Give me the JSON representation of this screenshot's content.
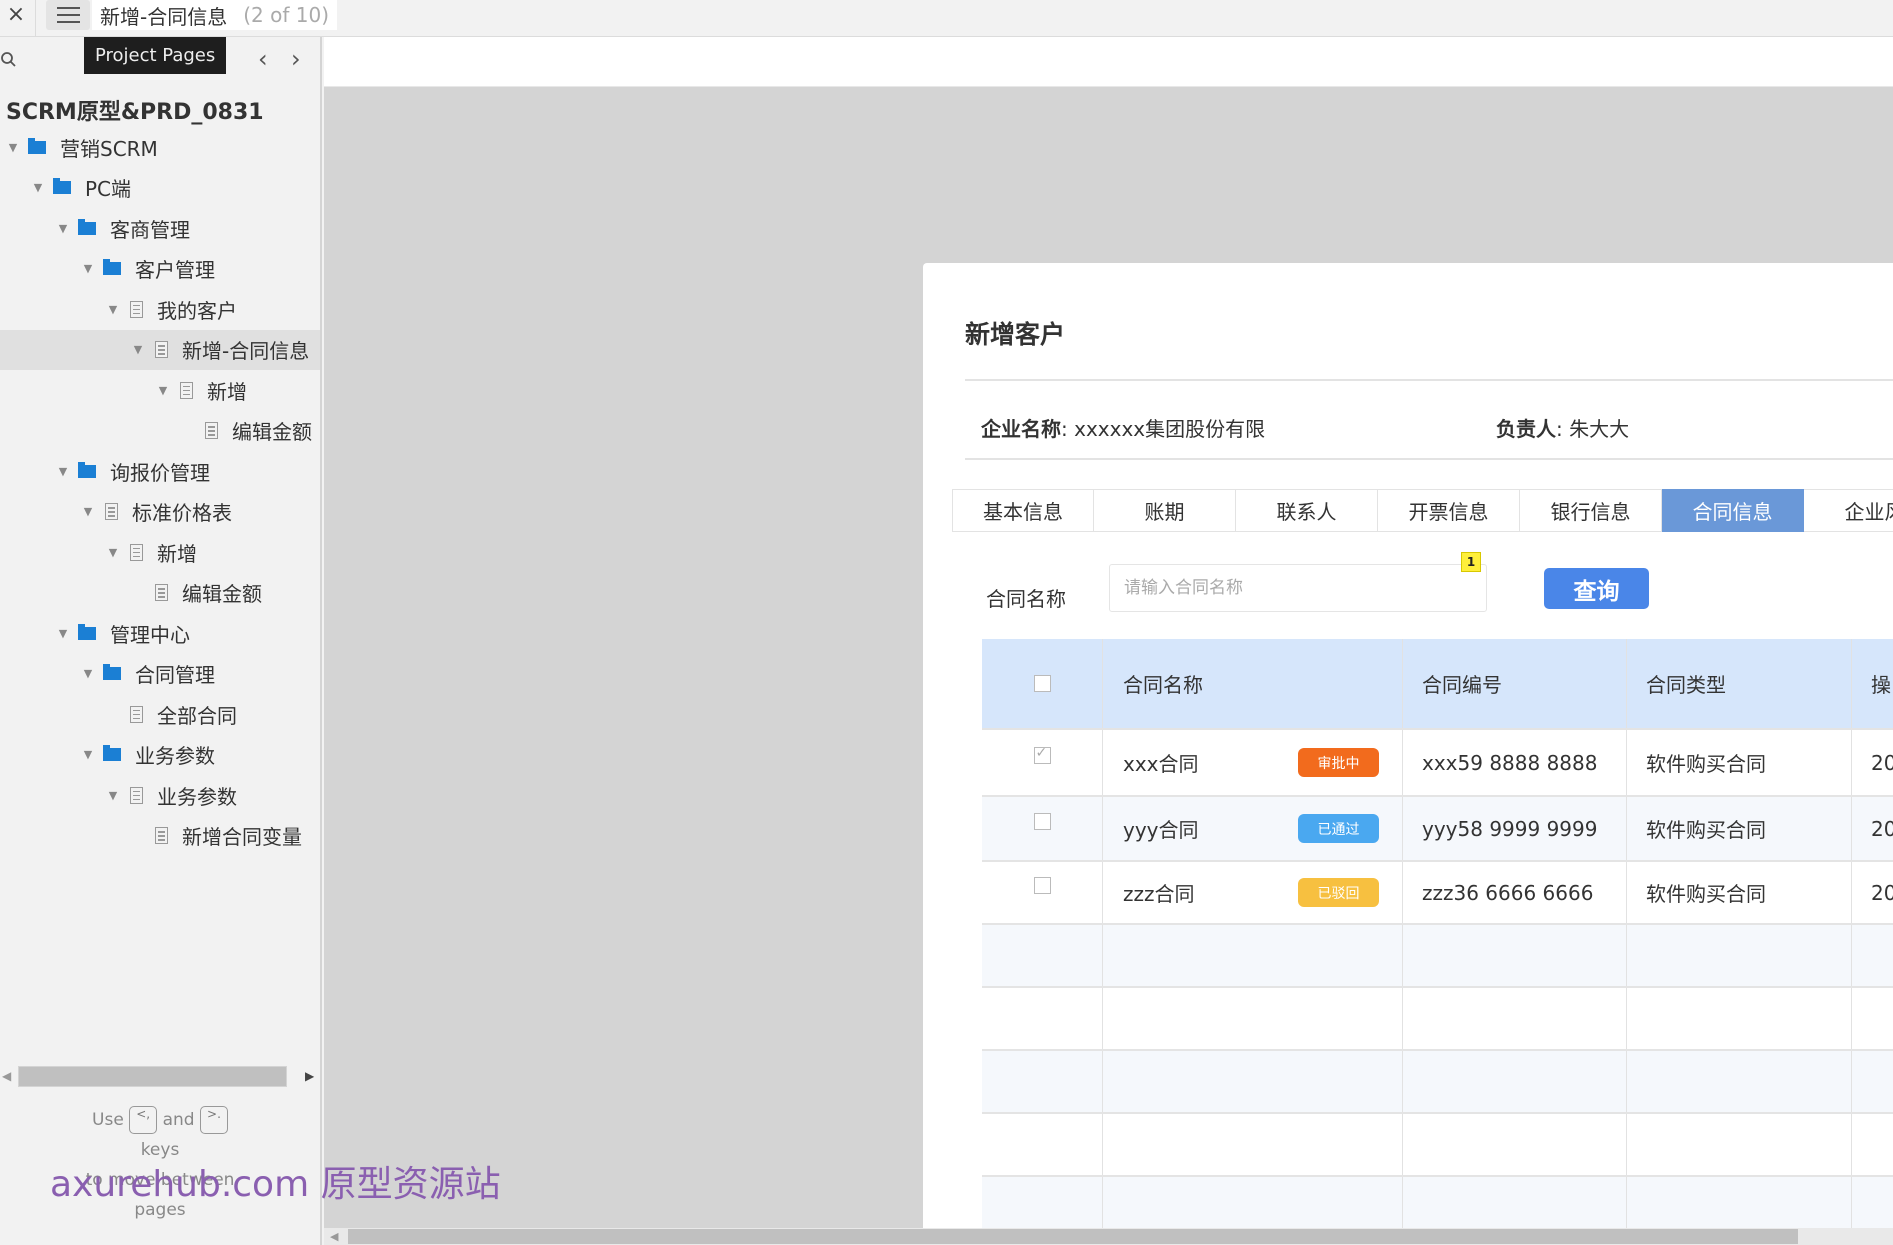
{
  "topbar": {
    "close_icon": "×",
    "page_title": "新增-合同信息",
    "page_count": "(2 of 10)"
  },
  "sidebar": {
    "tooltip": "Project Pages",
    "prev_icon": "‹",
    "next_icon": "›",
    "project_title": "SCRM原型&PRD_0831",
    "tree": [
      {
        "label": "营销SCRM",
        "type": "folder",
        "level": 0,
        "expanded": true
      },
      {
        "label": "PC端",
        "type": "folder",
        "level": 1,
        "expanded": true
      },
      {
        "label": "客商管理",
        "type": "folder",
        "level": 2,
        "expanded": true
      },
      {
        "label": "客户管理",
        "type": "folder",
        "level": 3,
        "expanded": true
      },
      {
        "label": "我的客户",
        "type": "page",
        "level": 4,
        "expanded": true
      },
      {
        "label": "新增-合同信息",
        "type": "page",
        "level": 5,
        "expanded": true,
        "selected": true
      },
      {
        "label": "新增",
        "type": "page",
        "level": 6,
        "expanded": true
      },
      {
        "label": "编辑金额",
        "type": "page",
        "level": 7,
        "expanded": false,
        "leaf": true
      },
      {
        "label": "询报价管理",
        "type": "folder",
        "level": 2,
        "expanded": true
      },
      {
        "label": "标准价格表",
        "type": "page",
        "level": 3,
        "expanded": true
      },
      {
        "label": "新增",
        "type": "page",
        "level": 4,
        "expanded": true
      },
      {
        "label": "编辑金额",
        "type": "page",
        "level": 5,
        "leaf": true
      },
      {
        "label": "管理中心",
        "type": "folder",
        "level": 2,
        "expanded": true
      },
      {
        "label": "合同管理",
        "type": "folder",
        "level": 3,
        "expanded": true
      },
      {
        "label": "全部合同",
        "type": "page",
        "level": 4,
        "leaf": true
      },
      {
        "label": "业务参数",
        "type": "folder",
        "level": 3,
        "expanded": true
      },
      {
        "label": "业务参数",
        "type": "page",
        "level": 4,
        "expanded": true
      },
      {
        "label": "新增合同变量",
        "type": "page",
        "level": 5,
        "leaf": true
      }
    ],
    "hint": {
      "use": "Use",
      "key_prev": "<,",
      "and": "and",
      "key_next": ">.",
      "keys": "keys",
      "to_move": "to move between",
      "pages": "pages"
    }
  },
  "watermark": "axurehub.com 原型资源站",
  "dialog": {
    "title": "新增客户",
    "company_label": "企业名称",
    "company_value": "xxxxxx集团股份有限",
    "owner_label": "负责人",
    "owner_value": "朱大大",
    "tabs": [
      {
        "label": "基本信息",
        "active": false
      },
      {
        "label": "账期",
        "active": false
      },
      {
        "label": "联系人",
        "active": false
      },
      {
        "label": "开票信息",
        "active": false
      },
      {
        "label": "银行信息",
        "active": false
      },
      {
        "label": "合同信息",
        "active": true
      },
      {
        "label": "企业风",
        "active": false
      }
    ],
    "filter": {
      "label": "合同名称",
      "placeholder": "请输入合同名称",
      "value": "",
      "note_badge": "1",
      "query_button": "查询"
    },
    "table": {
      "columns": [
        "合同名称",
        "合同编号",
        "合同类型",
        "操"
      ],
      "rows": [
        {
          "checked": true,
          "name": "xxx合同",
          "status": "审批中",
          "status_color": "#f26b1d",
          "number": "xxx59 8888 8888",
          "type": "软件购买合同",
          "op": "20"
        },
        {
          "checked": false,
          "name": "yyy合同",
          "status": "已通过",
          "status_color": "#4aa8f0",
          "number": "yyy58 9999 9999",
          "type": "软件购买合同",
          "op": "20"
        },
        {
          "checked": false,
          "name": "zzz合同",
          "status": "已驳回",
          "status_color": "#f7c040",
          "number": "zzz36 6666 6666",
          "type": "软件购买合同",
          "op": "20"
        }
      ],
      "empty_rows": 5
    }
  }
}
